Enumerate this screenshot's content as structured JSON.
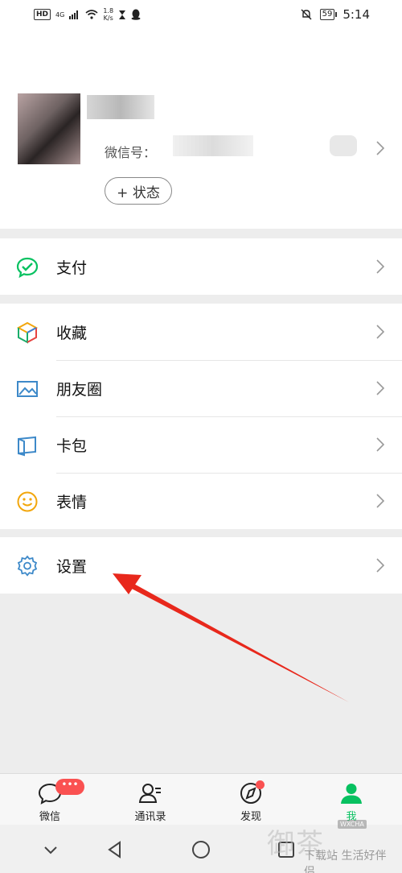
{
  "status_bar": {
    "hd": "HD",
    "network": "4G",
    "speed": "1.8",
    "speed_unit": "K/s",
    "battery": "59",
    "time": "5:14"
  },
  "profile": {
    "wechat_id_label": "微信号：",
    "status_button": "+ 状态"
  },
  "menu": {
    "pay": "支付",
    "favorites": "收藏",
    "moments": "朋友圈",
    "cards": "卡包",
    "stickers": "表情",
    "settings": "设置"
  },
  "tabbar": {
    "chats": "微信",
    "chats_badge": "•••",
    "contacts": "通讯录",
    "discover": "发现",
    "me": "我"
  },
  "watermark": {
    "main": "御茶",
    "badge": "WXCHA",
    "sub": "下载站 生活好伴侣"
  },
  "colors": {
    "brand_green": "#07c160",
    "badge_red": "#fa5151",
    "arrow_red": "#e8281c"
  }
}
